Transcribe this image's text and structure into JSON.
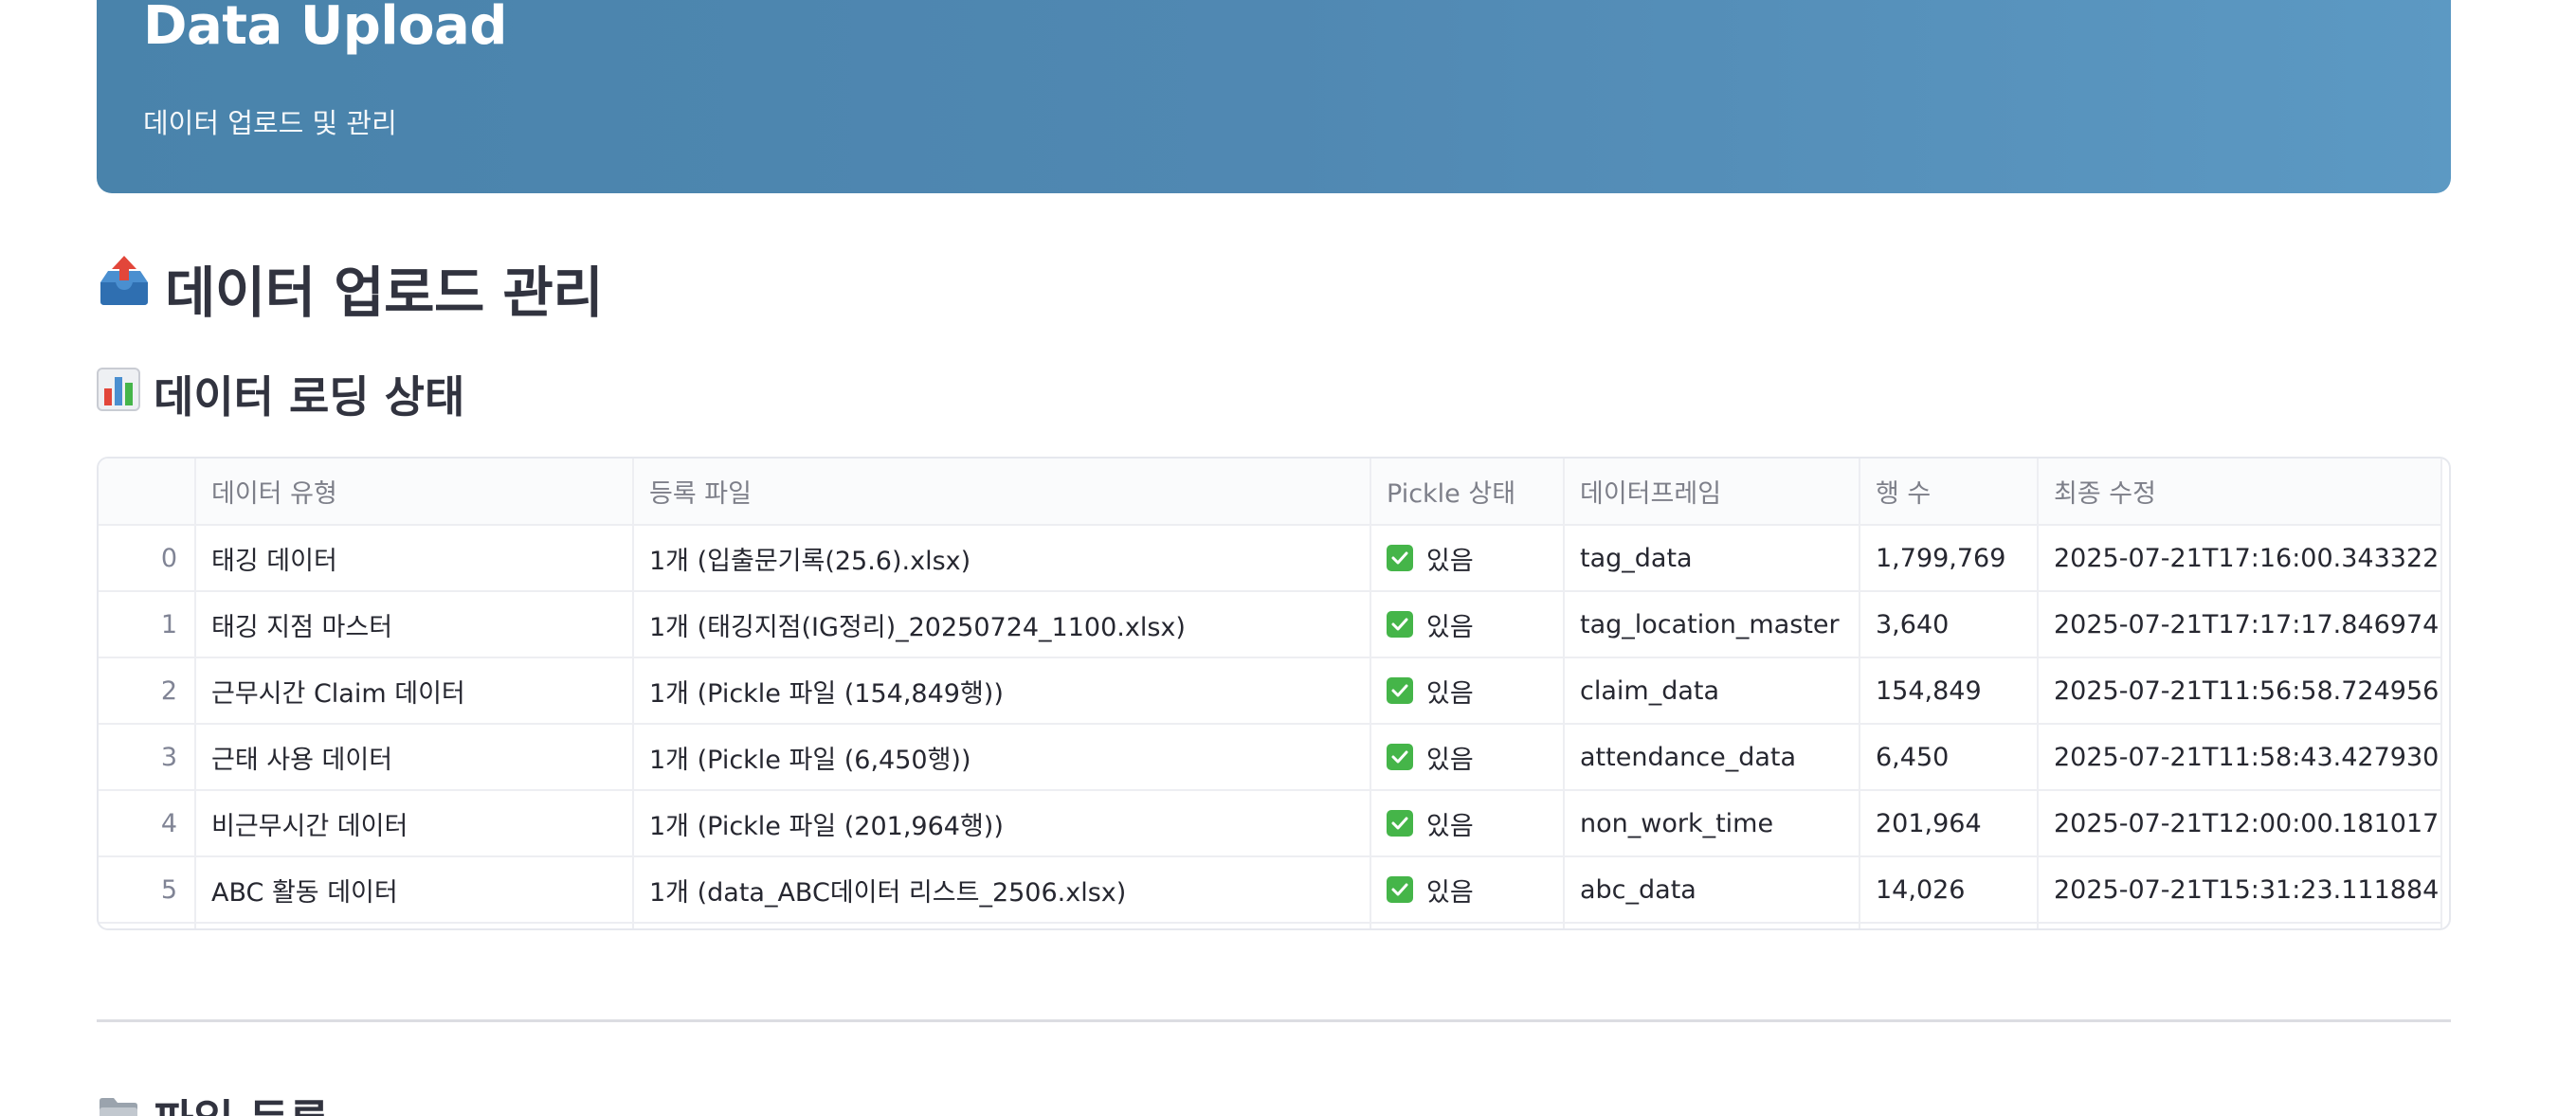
{
  "header": {
    "title": "Data Upload",
    "subtitle": "데이터 업로드 및 관리"
  },
  "section_main": {
    "icon": "outbox-tray-icon",
    "title": "데이터 업로드 관리"
  },
  "section_status": {
    "icon": "bar-chart-icon",
    "title": "데이터 로딩 상태"
  },
  "status_table": {
    "columns": [
      "",
      "데이터 유형",
      "등록 파일",
      "Pickle 상태",
      "데이터프레임",
      "행 수",
      "최종 수정"
    ],
    "status_icon": "check-mark-icon",
    "rows": [
      {
        "index": "0",
        "type": "태깅 데이터",
        "file": "1개 (입출문기록(25.6).xlsx)",
        "pickle": "있음",
        "dataframe": "tag_data",
        "rows": "1,799,769",
        "modified": "2025-07-21T17:16:00.343322"
      },
      {
        "index": "1",
        "type": "태깅 지점 마스터",
        "file": "1개 (태깅지점(IG정리)_20250724_1100.xlsx)",
        "pickle": "있음",
        "dataframe": "tag_location_master",
        "rows": "3,640",
        "modified": "2025-07-21T17:17:17.846974"
      },
      {
        "index": "2",
        "type": "근무시간 Claim 데이터",
        "file": "1개 (Pickle 파일 (154,849행))",
        "pickle": "있음",
        "dataframe": "claim_data",
        "rows": "154,849",
        "modified": "2025-07-21T11:56:58.724956"
      },
      {
        "index": "3",
        "type": "근태 사용 데이터",
        "file": "1개 (Pickle 파일 (6,450행))",
        "pickle": "있음",
        "dataframe": "attendance_data",
        "rows": "6,450",
        "modified": "2025-07-21T11:58:43.427930"
      },
      {
        "index": "4",
        "type": "비근무시간 데이터",
        "file": "1개 (Pickle 파일 (201,964행))",
        "pickle": "있음",
        "dataframe": "non_work_time",
        "rows": "201,964",
        "modified": "2025-07-21T12:00:00.181017"
      },
      {
        "index": "5",
        "type": "ABC 활동 데이터",
        "file": "1개 (data_ABC데이터 리스트_2506.xlsx)",
        "pickle": "있음",
        "dataframe": "abc_data",
        "rows": "14,026",
        "modified": "2025-07-21T15:31:23.111884"
      }
    ]
  },
  "section_files": {
    "icon": "file-folder-icon",
    "title": "파일 등록"
  },
  "colors": {
    "header_gradient_start": "#4983ab",
    "header_gradient_end": "#5c99c3",
    "check_green": "#45b549",
    "heading_text": "#31333f"
  }
}
